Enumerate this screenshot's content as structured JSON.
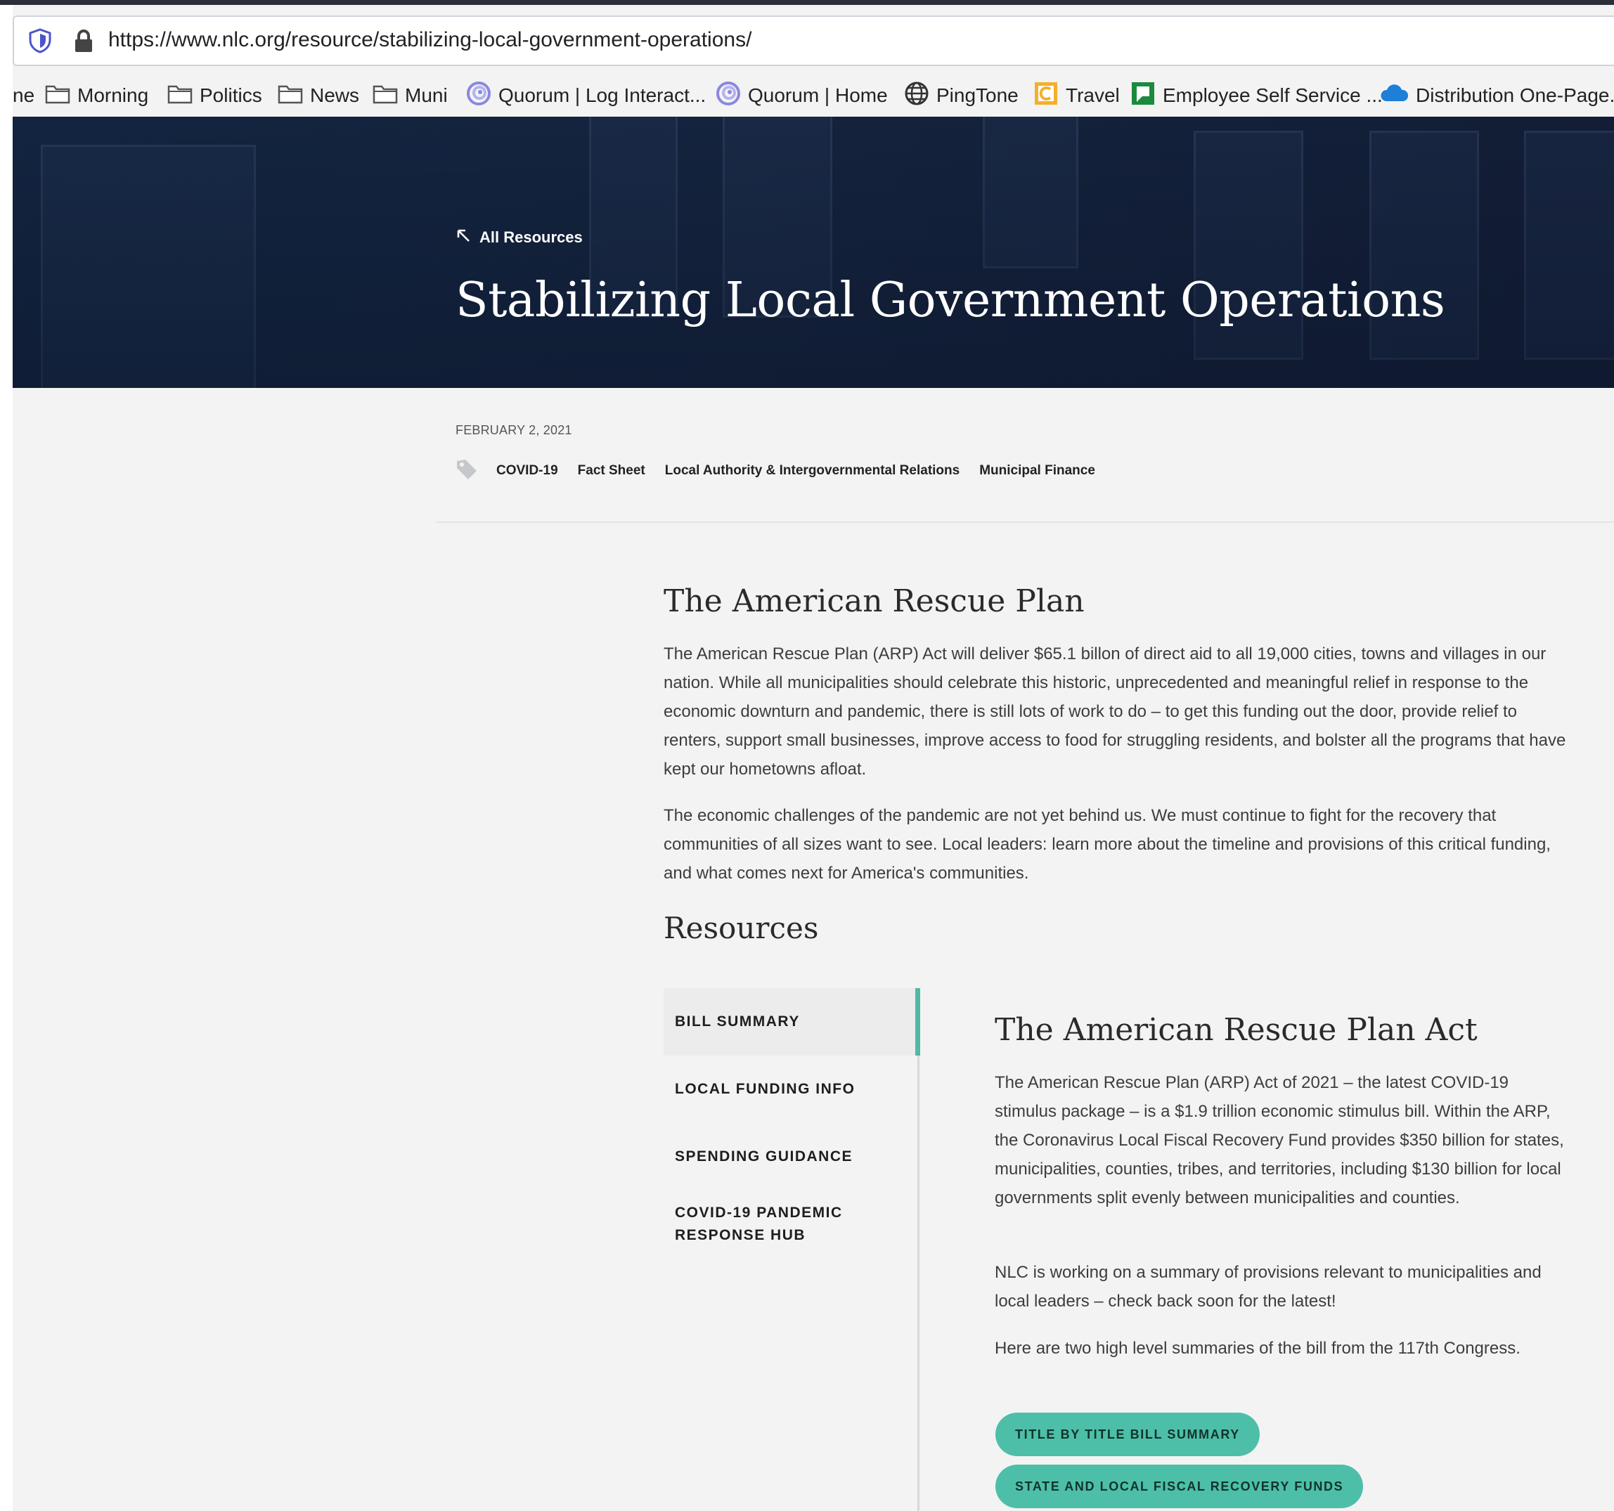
{
  "browser": {
    "url": "https://www.nlc.org/resource/stabilizing-local-government-operations/",
    "bookmarks": [
      {
        "label": "ne",
        "icon": "truncated"
      },
      {
        "label": "Morning",
        "icon": "folder-icon"
      },
      {
        "label": "Politics",
        "icon": "folder-icon"
      },
      {
        "label": "News",
        "icon": "folder-icon"
      },
      {
        "label": "Muni",
        "icon": "folder-icon"
      },
      {
        "label": "Quorum | Log Interact...",
        "icon": "quorum-icon"
      },
      {
        "label": "Quorum | Home",
        "icon": "quorum-icon"
      },
      {
        "label": "PingTone",
        "icon": "globe-icon"
      },
      {
        "label": "Travel",
        "icon": "travel-icon"
      },
      {
        "label": "Employee Self Service ...",
        "icon": "ess-icon"
      },
      {
        "label": "Distribution One-Page...",
        "icon": "cloud-icon"
      }
    ]
  },
  "hero": {
    "back_link": "All Resources",
    "title": "Stabilizing Local Government Operations"
  },
  "meta": {
    "date": "FEBRUARY 2, 2021",
    "tags": [
      "COVID-19",
      "Fact Sheet",
      "Local Authority & Intergovernmental Relations",
      "Municipal Finance"
    ]
  },
  "article": {
    "heading": "The American Rescue Plan",
    "paragraphs": [
      "The American Rescue Plan (ARP) Act will deliver $65.1 billon of direct aid to all 19,000 cities, towns and villages in our nation. While all municipalities should celebrate this historic, unprecedented and meaningful relief in response to the economic downturn and pandemic, there is still lots of work to do – to get this funding out the door, provide relief to renters, support small businesses, improve access to food for struggling residents, and bolster all the programs that have kept our hometowns afloat.",
      "The economic challenges of the pandemic are not yet behind us. We must continue to fight for the recovery that communities of all sizes want to see. Local leaders: learn more about the timeline and provisions of this critical funding, and what comes next for America's communities."
    ],
    "resources_heading": "Resources"
  },
  "resources": {
    "tabs": [
      "BILL SUMMARY",
      "LOCAL FUNDING INFO",
      "SPENDING GUIDANCE",
      "COVID-19 PANDEMIC RESPONSE HUB"
    ],
    "active_tab": "BILL SUMMARY",
    "panel": {
      "heading": "The American Rescue Plan Act",
      "paragraphs": [
        "The American Rescue Plan (ARP) Act of 2021 – the latest COVID-19 stimulus package – is a $1.9 trillion economic stimulus bill. Within the ARP, the Coronavirus Local Fiscal Recovery Fund provides $350 billion for states, municipalities, counties, tribes, and territories, including $130 billion for local governments split evenly between municipalities and counties.",
        "NLC is working on a summary of provisions relevant to municipalities and local leaders – check back soon for the latest!",
        "Here are two high level summaries of the bill from the 117th Congress."
      ],
      "buttons": [
        "TITLE BY TITLE BILL SUMMARY",
        "STATE AND LOCAL FISCAL RECOVERY FUNDS"
      ]
    }
  },
  "colors": {
    "accent": "#4dbfa8",
    "hero_overlay": "#1c2d4a",
    "page_bg": "#f3f3f3"
  }
}
